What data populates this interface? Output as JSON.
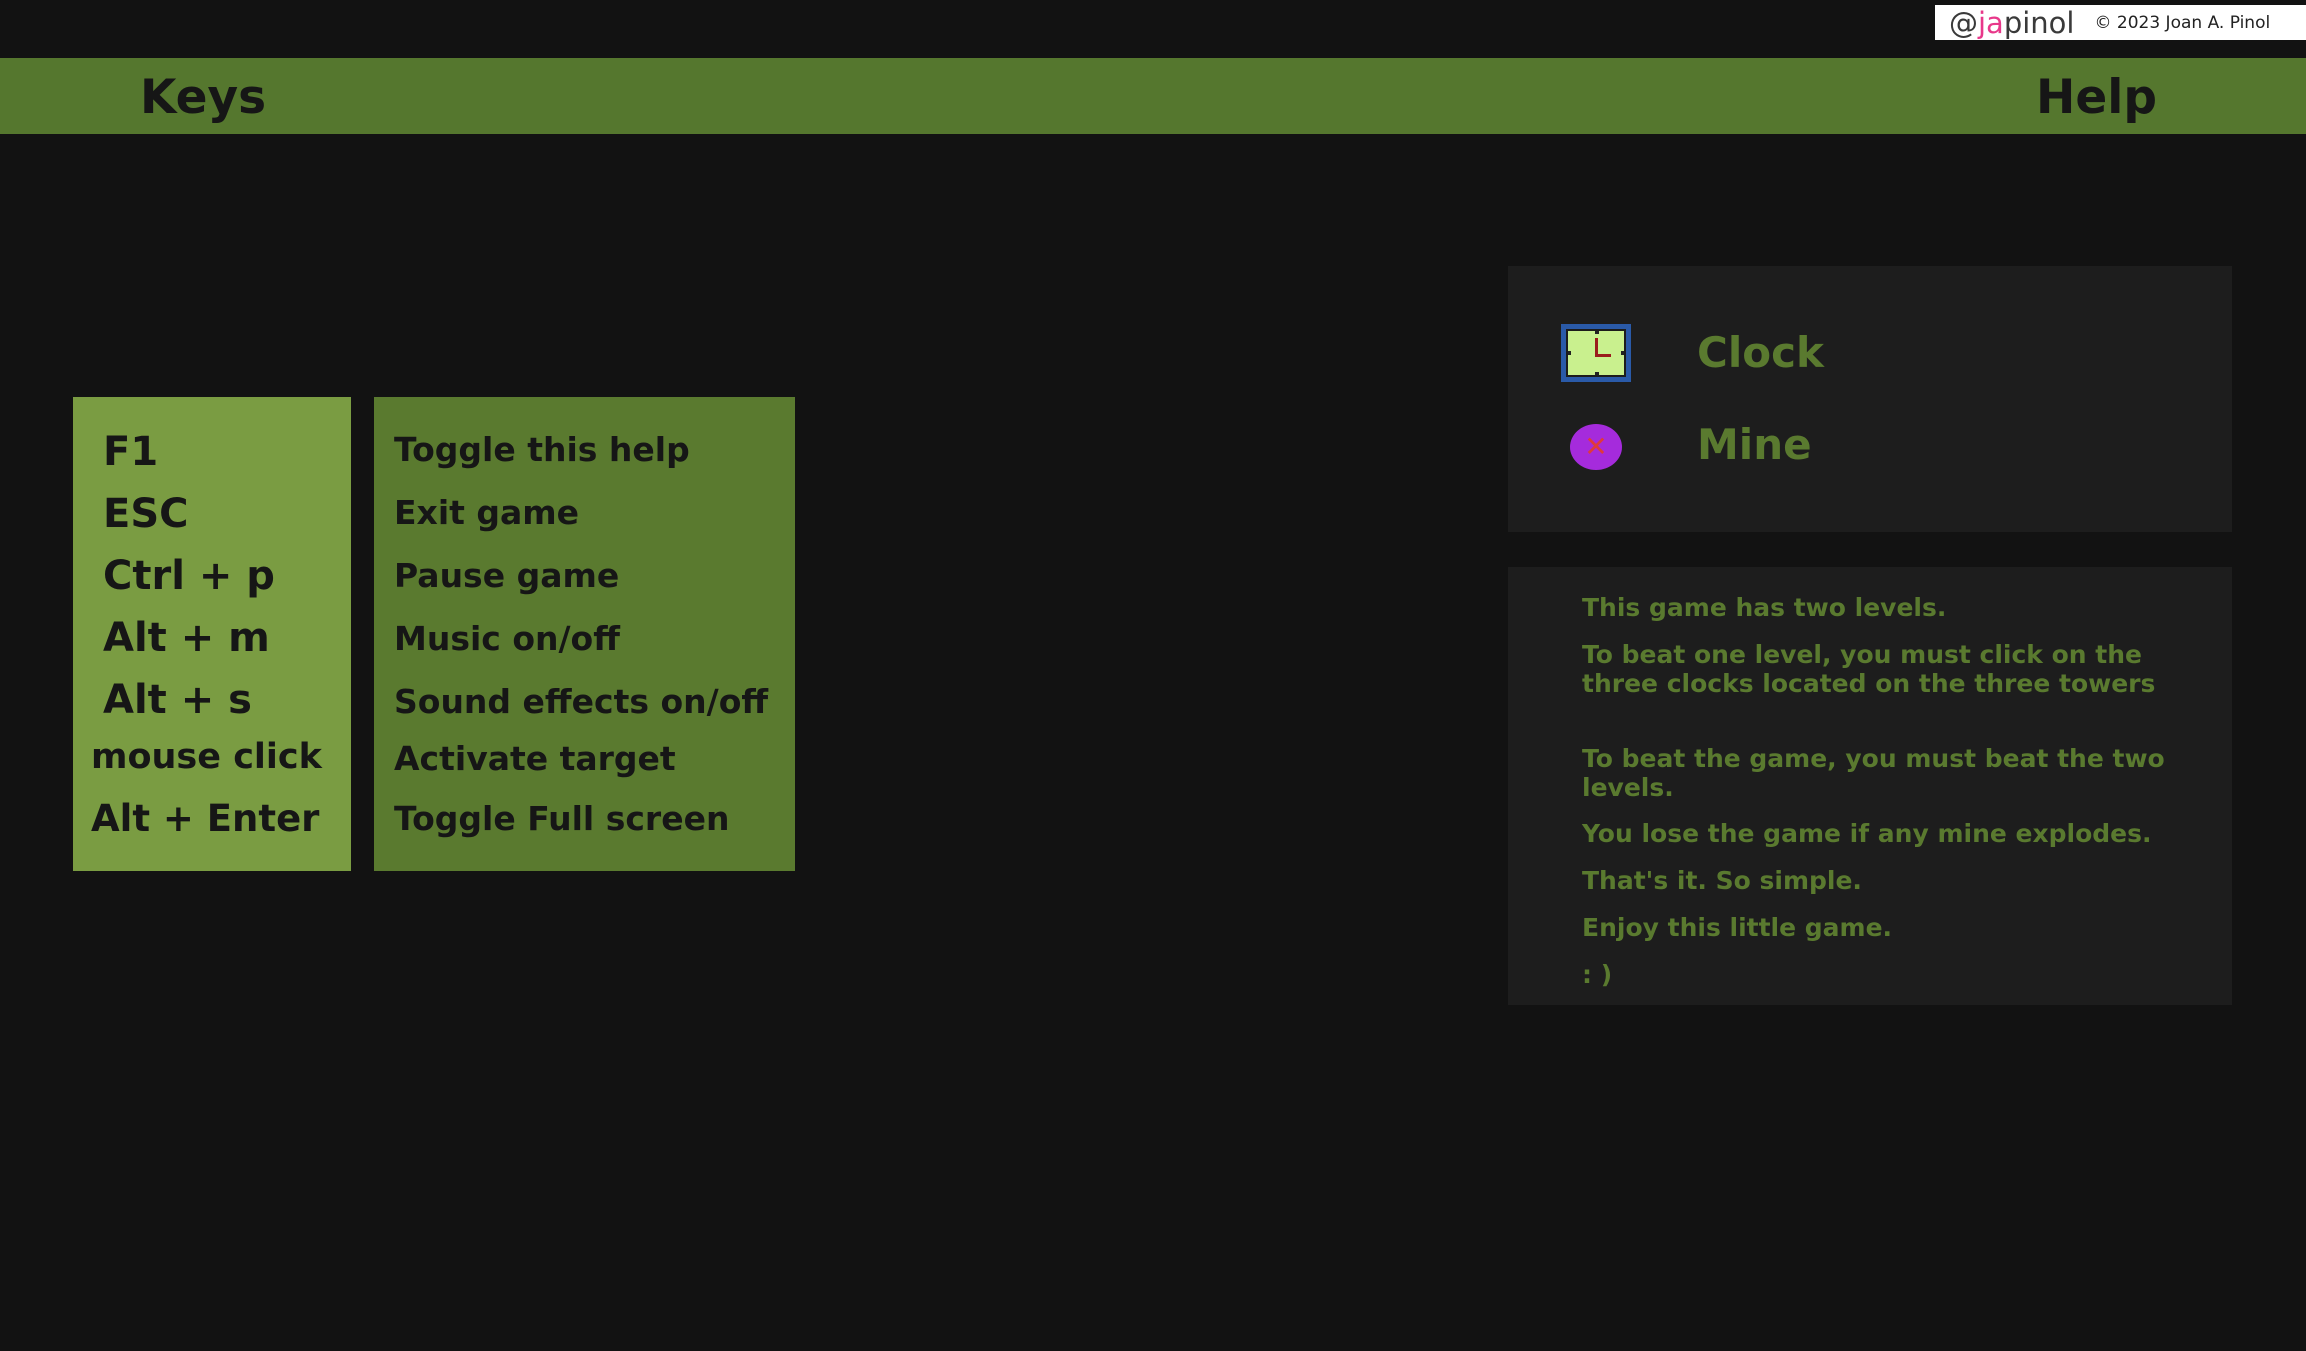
{
  "credit": {
    "handle_prefix": "@",
    "handle_highlight": "ja",
    "handle_suffix": "pinol",
    "copyright": "© 2023 Joan A. Pinol"
  },
  "header": {
    "left_title": "Keys",
    "right_title": "Help"
  },
  "keys": [
    {
      "key": "F1",
      "action": "Toggle this help"
    },
    {
      "key": "ESC",
      "action": "Exit game"
    },
    {
      "key": "Ctrl + p",
      "action": "Pause game"
    },
    {
      "key": "Alt + m",
      "action": "Music on/off"
    },
    {
      "key": "Alt + s",
      "action": "Sound effects on/off"
    },
    {
      "key": "mouse click",
      "action": "Activate target"
    },
    {
      "key": "Alt + Enter",
      "action": "Toggle Full screen"
    }
  ],
  "legend": [
    {
      "icon": "clock-icon",
      "label": "Clock"
    },
    {
      "icon": "mine-icon",
      "label": "Mine"
    }
  ],
  "help_text": [
    "This game has two levels.",
    "To beat one level, you must click on the three clocks located on the three towers",
    "To beat the game, you must beat the two levels.",
    "You lose the game if any mine explodes.",
    "That's it. So simple.",
    "Enjoy this little game.",
    ": )"
  ],
  "colors": {
    "background": "#121212",
    "header": "#55772e",
    "keys_panel": "#7a9c42",
    "desc_panel": "#5a7a2f",
    "text_green": "#5a7a2f",
    "mine": "#a52bdc",
    "clock_frame": "#2a5aa8"
  }
}
